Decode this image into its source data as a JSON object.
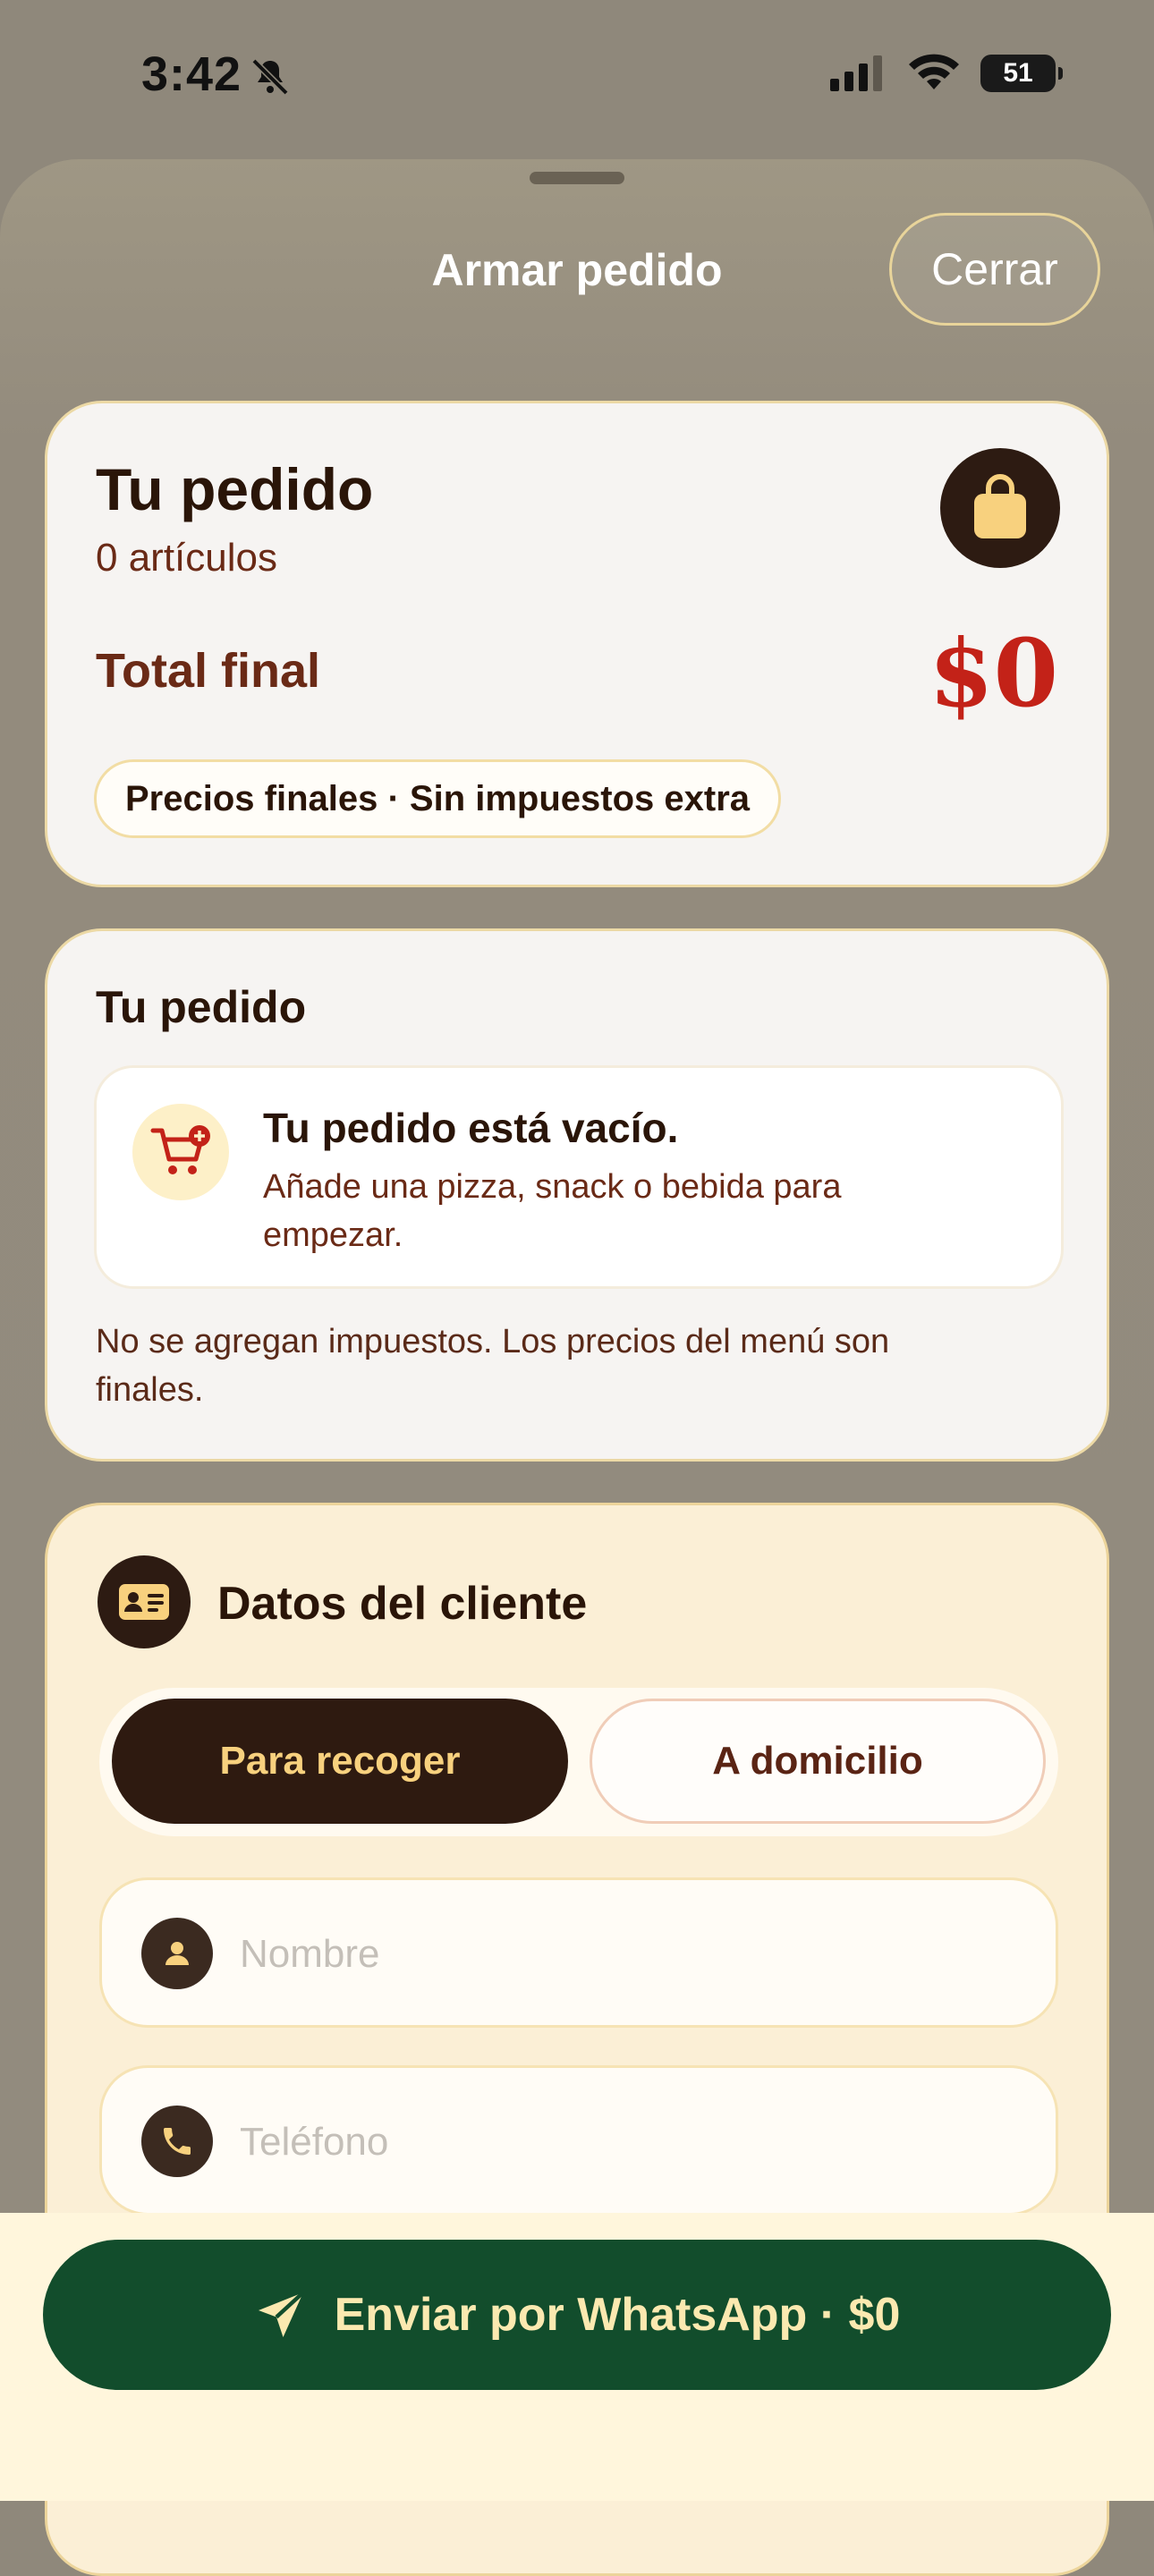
{
  "status": {
    "time": "3:42",
    "battery": "51"
  },
  "sheet": {
    "title": "Armar pedido",
    "close_label": "Cerrar"
  },
  "summary": {
    "title": "Tu pedido",
    "count": "0 artículos",
    "total_label": "Total final",
    "total_value": "$0",
    "pill": "Precios finales · Sin impuestos extra"
  },
  "order": {
    "title": "Tu pedido",
    "empty_title": "Tu pedido está vacío.",
    "empty_sub": "Añade una pizza, snack o bebida para empezar.",
    "note": "No se agregan impuestos. Los precios del menú son finales."
  },
  "customer": {
    "title": "Datos del cliente",
    "pickup_label": "Para recoger",
    "delivery_label": "A domicilio",
    "name_placeholder": "Nombre",
    "phone_placeholder": "Teléfono"
  },
  "send": {
    "label": "Enviar por WhatsApp · $0"
  },
  "colors": {
    "accent_dark": "#2e1a10",
    "gold": "#f8d17e",
    "price_red": "#c32218",
    "whatsapp_green": "#124d2c"
  },
  "icons": [
    "bell-slash-icon",
    "signal-icon",
    "wifi-icon",
    "battery-icon",
    "shopping-bag-icon",
    "cart-plus-icon",
    "id-card-icon",
    "user-icon",
    "phone-icon",
    "send-icon"
  ]
}
